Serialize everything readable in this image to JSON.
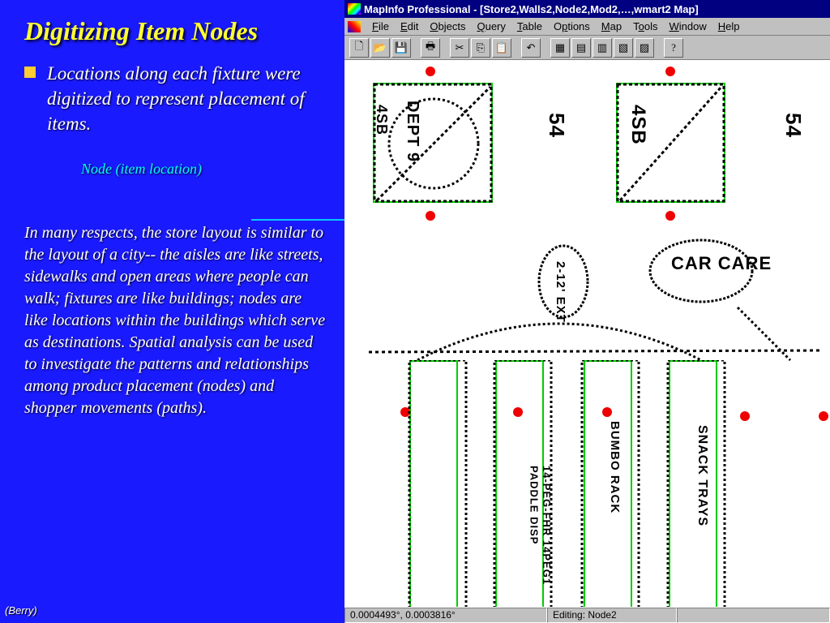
{
  "slide": {
    "title": "Digitizing Item Nodes",
    "bullet": "Locations along each fixture were digitized to represent placement of items.",
    "node_label": "Node (item location)",
    "paragraph": "In many respects, the store layout is similar to the layout of a city-- the aisles are like streets, sidewalks and open areas where people can walk; fixtures are like buildings; nodes are like locations within the buildings which serve as destinations. Spatial analysis can be used to investigate the patterns and relationships among product placement (nodes) and shopper movements (paths).",
    "attribution": "(Berry)"
  },
  "app": {
    "window_title": "MapInfo Professional - [Store2,Walls2,Node2,Mod2,…,wmart2 Map]",
    "menus": [
      "File",
      "Edit",
      "Objects",
      "Query",
      "Table",
      "Options",
      "Map",
      "Tools",
      "Window",
      "Help"
    ],
    "status": {
      "coords": "0.0004493°, 0.0003816°",
      "editing": "Editing: Node2"
    },
    "map_labels": {
      "top_left_box": "DEPT 9",
      "top_left_side": "4SB",
      "top_right_box": "4SB",
      "mid_54_a": "54",
      "mid_54_b": "54",
      "mid_ext": "2-12' EXT",
      "car_care": "CAR CARE",
      "bottom_a": "SNACK TRAYS",
      "bottom_b": "BUMBO RACK",
      "bottom_c": "14-PEG-FHR 14PEG1 PADDLE DISP"
    }
  }
}
